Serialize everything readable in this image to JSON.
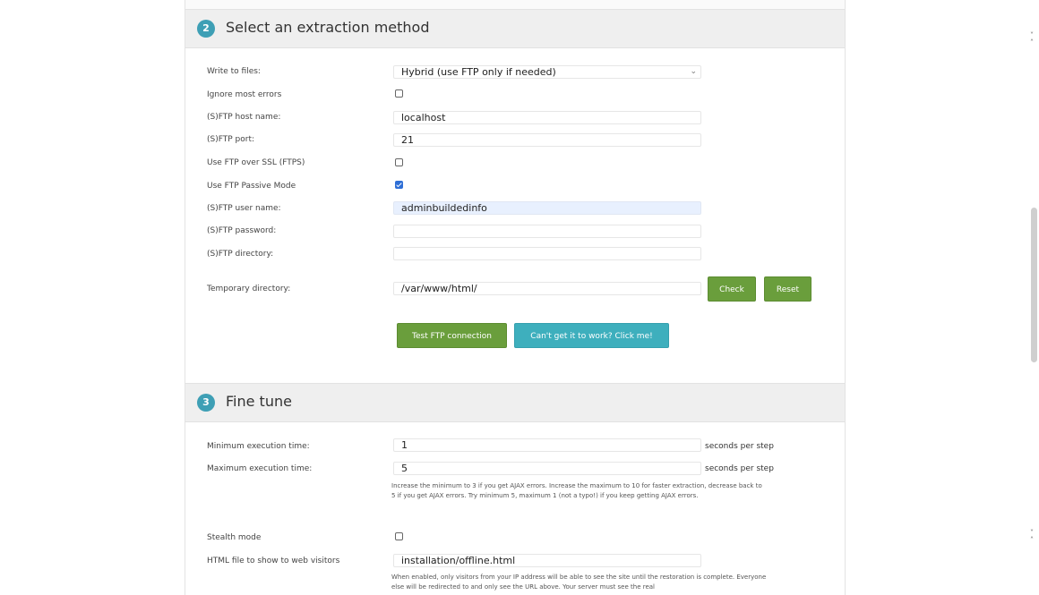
{
  "section2": {
    "number": "2",
    "title": "Select an extraction method",
    "rows": {
      "write_to_files": {
        "label": "Write to files:",
        "value": "Hybrid (use FTP only if needed)"
      },
      "ignore_errors": {
        "label": "Ignore most errors",
        "checked": false
      },
      "host": {
        "label": "(S)FTP host name:",
        "value": "localhost"
      },
      "port": {
        "label": "(S)FTP port:",
        "value": "21"
      },
      "ftps": {
        "label": "Use FTP over SSL (FTPS)",
        "checked": false
      },
      "passive": {
        "label": "Use FTP Passive Mode",
        "checked": true
      },
      "user": {
        "label": "(S)FTP user name:",
        "value": "adminbuildedinfo"
      },
      "password": {
        "label": "(S)FTP password:",
        "value": ""
      },
      "directory": {
        "label": "(S)FTP directory:",
        "value": ""
      },
      "temp_dir": {
        "label": "Temporary directory:",
        "value": "/var/www/html/"
      }
    },
    "buttons": {
      "check": "Check",
      "reset": "Reset",
      "test_ftp": "Test FTP connection",
      "help": "Can't get it to work? Click me!"
    }
  },
  "section3": {
    "number": "3",
    "title": "Fine tune",
    "min_exec": {
      "label": "Minimum execution time:",
      "value": "1",
      "unit": "seconds per step"
    },
    "max_exec": {
      "label": "Maximum execution time:",
      "value": "5",
      "unit": "seconds per step"
    },
    "exec_help": "Increase the minimum to 3 if you get AJAX errors. Increase the maximum to 10 for faster extraction, decrease back to 5 if you get AJAX errors. Try minimum 5, maximum 1 (not a typo!) if you keep getting AJAX errors.",
    "stealth": {
      "label": "Stealth mode",
      "checked": false
    },
    "html_file": {
      "label": "HTML file to show to web visitors",
      "value": "installation/offline.html"
    },
    "stealth_help": "When enabled, only visitors from your IP address will be able to see the site until the restoration is complete. Everyone else will be redirected to and only see the URL above. Your server must see the real"
  },
  "colors": {
    "green": "#6a9e3c",
    "teal": "#3eafbd",
    "step_badge": "#3e9fb5"
  }
}
